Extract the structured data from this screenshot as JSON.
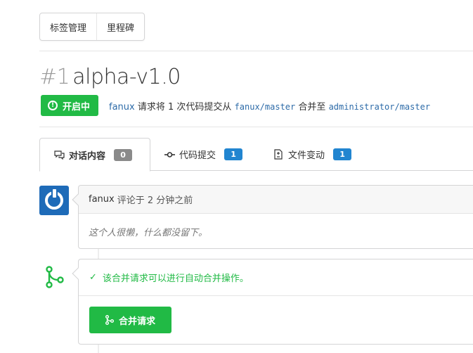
{
  "topnav": {
    "labels_button": "标签管理",
    "milestones_button": "里程碑"
  },
  "pr": {
    "number": "#1",
    "title": "alpha-v1.0",
    "status": "开启中",
    "user": "fanux",
    "desc_1": "请求将 1 次代码提交从",
    "head_branch": "fanux/master",
    "desc_2": "合并至",
    "base_branch": "administrator/master"
  },
  "tabs": [
    {
      "label": "对话内容",
      "count": "0",
      "icon": "comments-icon"
    },
    {
      "label": "代码提交",
      "count": "1",
      "icon": "commit-icon"
    },
    {
      "label": "文件变动",
      "count": "1",
      "icon": "file-diff-icon"
    }
  ],
  "comment": {
    "author": "fanux",
    "meta": "评论于 2 分钟之前",
    "body": "这个人很懒，什么都没留下。"
  },
  "merge": {
    "status_text": "该合并请求可以进行自动合并操作。",
    "button_label": "合并请求"
  },
  "colors": {
    "green": "#21ba45",
    "blue": "#2185d0",
    "link": "#2d6ba8",
    "avatar": "#1e6bb8"
  }
}
